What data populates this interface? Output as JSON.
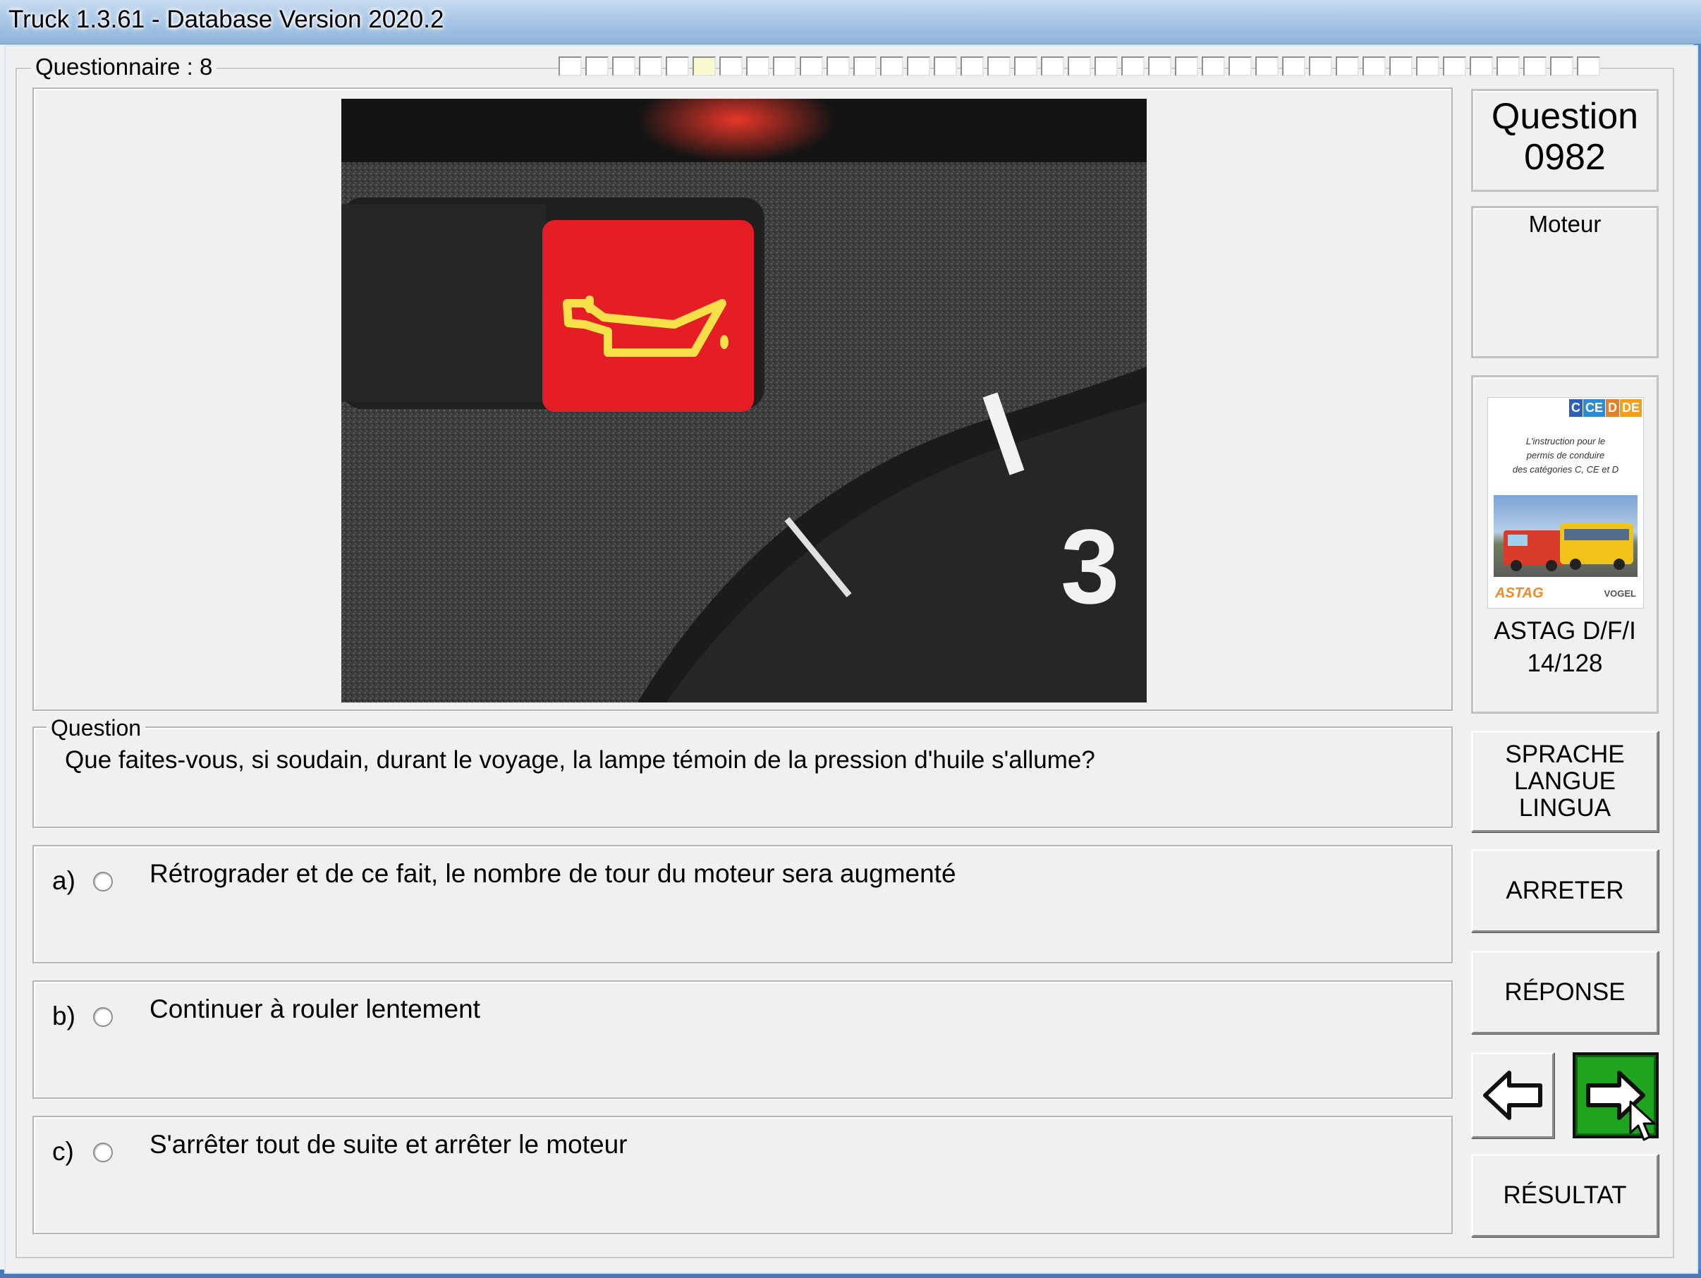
{
  "window": {
    "title": "Truck 1.3.61 - Database Version 2020.2"
  },
  "questionnaire": {
    "label": "Questionnaire : 8",
    "progress": {
      "total": 39,
      "current": 6
    }
  },
  "image": {
    "description_icon": "oil-pressure-warning-icon",
    "gauge_number": "3"
  },
  "question": {
    "section_label": "Question",
    "text": "Que faites-vous, si soudain, durant le voyage, la lampe témoin de la pression d'huile s'allume?"
  },
  "answers": [
    {
      "letter": "a)",
      "text": "Rétrograder et de ce fait, le nombre de tour du moteur sera augmenté",
      "selected": false
    },
    {
      "letter": "b)",
      "text": "Continuer à rouler lentement",
      "selected": false
    },
    {
      "letter": "c)",
      "text": "S'arrêter tout de suite et arrêter le moteur",
      "selected": false
    }
  ],
  "sidebar": {
    "question_label": "Question",
    "question_number": "0982",
    "category": "Moteur",
    "book": {
      "tags": [
        "C",
        "CE",
        "D",
        "DE"
      ],
      "tag_colors": [
        "#2f5fb3",
        "#2f8bd0",
        "#e0812e",
        "#f0a020"
      ],
      "cover_text": "L'instruction pour le\npermis de conduire\ndes catégories C, CE et D",
      "publisher_left": "ASTAG",
      "publisher_right": "VOGEL",
      "name": "ASTAG D/F/I",
      "page": "14/128"
    },
    "buttons": {
      "language_lines": [
        "SPRACHE",
        "LANGUE",
        "LINGUA"
      ],
      "stop": "ARRETER",
      "answer": "RÉPONSE",
      "result": "RÉSULTAT",
      "prev_icon": "arrow-left-icon",
      "next_icon": "arrow-right-icon"
    }
  },
  "colors": {
    "next_button": "#1ea41e",
    "warning_lamp": "#e51d24",
    "warning_symbol": "#f5e04a"
  }
}
